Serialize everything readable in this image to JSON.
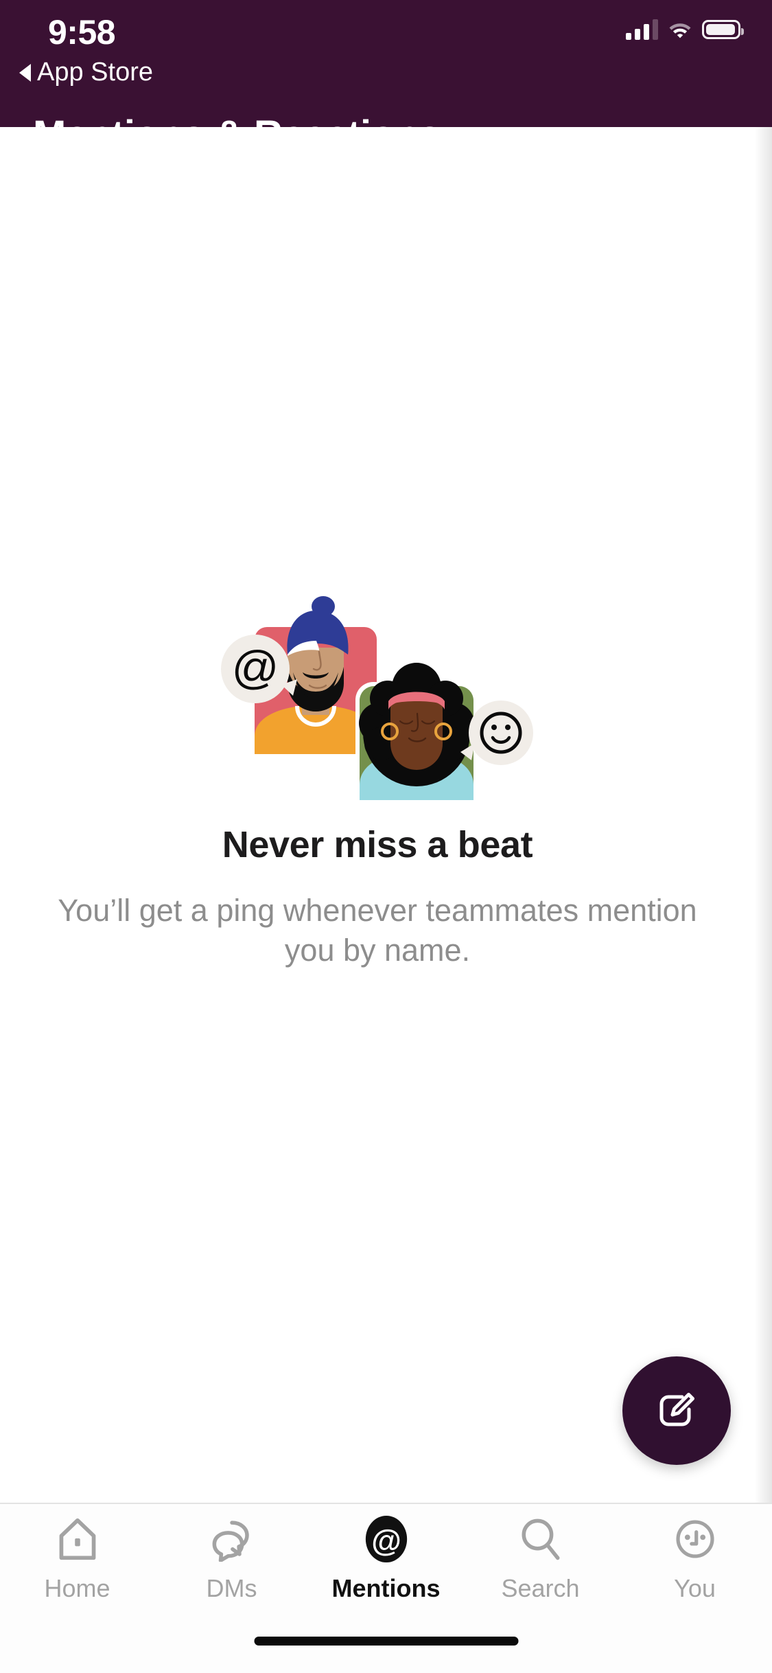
{
  "status_bar": {
    "time": "9:58",
    "back_label": "App Store",
    "signal_icon": "cellular-bars-icon",
    "wifi_icon": "wifi-icon",
    "battery_icon": "battery-icon",
    "signal_bars_filled": 3,
    "signal_bars_total": 4,
    "battery_level_pct": 84
  },
  "header": {
    "title": "Mentions & Reactions",
    "background_color": "#3A1133",
    "text_color": "#FFFFFF"
  },
  "empty_state": {
    "illustration_name": "mentions-reactions-illustration",
    "headline": "Never miss a beat",
    "subtext": "You’ll get a ping whenever teammates mention you by name.",
    "headline_color": "#1D1C1D",
    "subtext_color": "#8D8D8D",
    "illustration": {
      "at_bubble_glyph": "@",
      "smiley_bubble_glyph": "smiley-face",
      "avatar_left_bg": "#E0606A",
      "avatar_right_bg": "#74904C",
      "turban_color": "#2E3C96",
      "shirt_color": "#F2A22E",
      "sweater_color": "#97D8E0",
      "headband_color": "#E8707C",
      "bubble_bg": "#F1EDE8",
      "hoop_earring_color": "#E8A33D"
    }
  },
  "compose_button": {
    "label": "Compose",
    "icon": "compose-pencil-icon",
    "background_color": "#301030"
  },
  "tab_bar": {
    "active_index": 2,
    "active_color": "#111111",
    "inactive_color": "#A3A3A3",
    "items": [
      {
        "label": "Home",
        "icon": "home-icon"
      },
      {
        "label": "DMs",
        "icon": "dms-speech-bubbles-icon"
      },
      {
        "label": "Mentions",
        "icon": "at-mention-icon"
      },
      {
        "label": "Search",
        "icon": "search-magnifier-icon"
      },
      {
        "label": "You",
        "icon": "you-face-icon"
      }
    ]
  },
  "home_indicator": {
    "name": "home-indicator"
  }
}
